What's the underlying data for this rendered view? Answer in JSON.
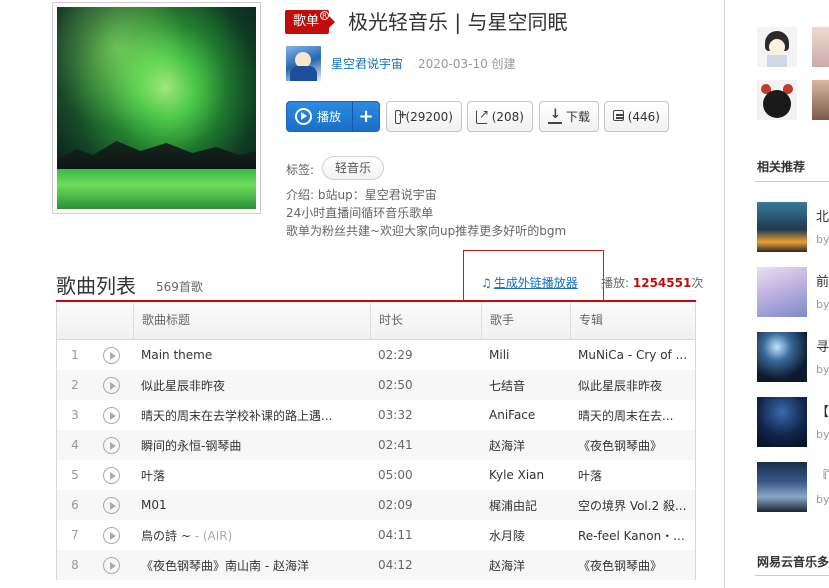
{
  "playlist": {
    "badge": "歌单",
    "badge_reg": "R",
    "title": "极光轻音乐 | 与星空同眠",
    "creator": "星空君说宇宙",
    "created": "2020-03-10 创建",
    "actions": {
      "play": "播放",
      "add": "+",
      "favorite": "(29200)",
      "share": "(208)",
      "download": "下载",
      "comment": "(446)"
    },
    "tags_label": "标签:",
    "tags": [
      "轻音乐"
    ],
    "desc": [
      "介绍:  b站up：星空君说宇宙",
      "24小时直播间循环音乐歌单",
      "歌单为粉丝共建~欢迎大家向up推荐更多好听的bgm"
    ]
  },
  "songlist": {
    "title": "歌曲列表",
    "count": "569首歌",
    "ext_player": "生成外链播放器",
    "play_label": "播放:",
    "play_count": "1254551",
    "play_suffix": "次",
    "columns": [
      "",
      "歌曲标题",
      "时长",
      "歌手",
      "专辑"
    ],
    "rows": [
      {
        "n": "1",
        "title": "Main theme",
        "alt": "",
        "dur": "02:29",
        "artist": "Mili",
        "album": "MuNiCa - Cry of ..."
      },
      {
        "n": "2",
        "title": "似此星辰非昨夜",
        "alt": "",
        "dur": "02:50",
        "artist": "七结音",
        "album": "似此星辰非昨夜"
      },
      {
        "n": "3",
        "title": "晴天的周末在去学校补课的路上遇...",
        "alt": "",
        "dur": "03:32",
        "artist": "AniFace",
        "album": "晴天的周末在去..."
      },
      {
        "n": "4",
        "title": "瞬间的永恒-钢琴曲",
        "alt": "",
        "dur": "02:41",
        "artist": "赵海洋",
        "album": "《夜色钢琴曲》"
      },
      {
        "n": "5",
        "title": "叶落",
        "alt": "",
        "dur": "05:00",
        "artist": "Kyle Xian",
        "album": "叶落"
      },
      {
        "n": "6",
        "title": "M01",
        "alt": "",
        "dur": "02:09",
        "artist": "梶浦由記",
        "album": "空の境界 Vol.2 殺..."
      },
      {
        "n": "7",
        "title": "鳥の詩 ~",
        "alt": " - (AIR)",
        "dur": "04:11",
        "artist": "水月陵",
        "album": "Re-feel Kanon・..."
      },
      {
        "n": "8",
        "title": "《夜色钢琴曲》南山南 - 赵海洋",
        "alt": "",
        "dur": "04:12",
        "artist": "赵海洋",
        "album": "《夜色钢琴曲》"
      }
    ]
  },
  "sidebar": {
    "related_title": "相关推荐",
    "recs": [
      {
        "t": "北",
        "by": "by"
      },
      {
        "t": "前",
        "by": "by"
      },
      {
        "t": "寻",
        "by": "by"
      },
      {
        "t": "【",
        "by": "by"
      },
      {
        "t": "『",
        "by": "by"
      }
    ],
    "bottom_title": "网易云音乐多"
  }
}
